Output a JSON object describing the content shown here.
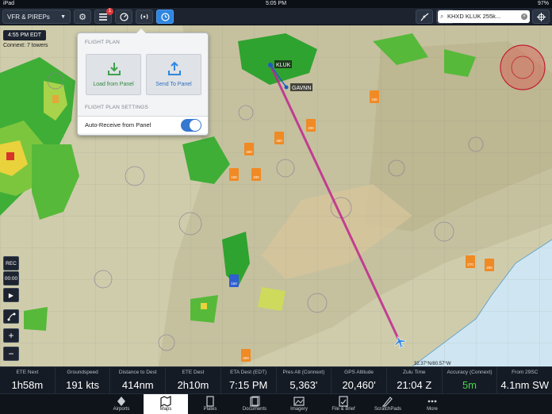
{
  "status_bar": {
    "device": "iPad",
    "time": "5:05 PM",
    "battery": "97%"
  },
  "toolbar": {
    "layer_selector": "VFR & PIREPs",
    "notification_count": "1",
    "search_value": "KHXD KLUK 255k..."
  },
  "map": {
    "time_chip": "4:55 PM EDT",
    "towers_label": "Connext: 7 towers",
    "waypoints": {
      "start": "KLUK",
      "mid": "GAVNN"
    },
    "aircraft_label": "32.37°N/80.57°W",
    "obstacle_labels": [
      "340",
      "200",
      "350",
      "400",
      "100",
      "200",
      "270",
      "200",
      "400"
    ],
    "airport_label": "150"
  },
  "flight_plan_popover": {
    "header": "FLIGHT PLAN",
    "load_label": "Load from Panel",
    "send_label": "Send To Panel",
    "settings_header": "FLIGHT PLAN SETTINGS",
    "auto_receive_label": "Auto-Receive from Panel",
    "auto_receive_on": true
  },
  "side_controls": {
    "rec": "REC",
    "timer": "00:00"
  },
  "instruments": [
    {
      "title": "ETE Next",
      "value": "1h58m"
    },
    {
      "title": "Groundspeed",
      "value": "191 kts"
    },
    {
      "title": "Distance to Dest",
      "value": "414nm"
    },
    {
      "title": "ETE Dest",
      "value": "2h10m"
    },
    {
      "title": "ETA Dest (EDT)",
      "value": "7:15 PM"
    },
    {
      "title": "Pres Alt (Connext)",
      "value": "5,363'"
    },
    {
      "title": "GPS Altitude",
      "value": "20,460'"
    },
    {
      "title": "Zulu Time",
      "value": "21:04 Z"
    },
    {
      "title": "Accuracy (Connext)",
      "value": "5m"
    },
    {
      "title": "From 29SC",
      "value": "4.1nm SW"
    }
  ],
  "tabs": [
    {
      "label": "Airports",
      "icon": "airports-icon"
    },
    {
      "label": "Maps",
      "icon": "maps-icon"
    },
    {
      "label": "Plates",
      "icon": "plates-icon"
    },
    {
      "label": "Documents",
      "icon": "documents-icon"
    },
    {
      "label": "Imagery",
      "icon": "imagery-icon"
    },
    {
      "label": "File & Brief",
      "icon": "file-brief-icon"
    },
    {
      "label": "ScratchPads",
      "icon": "scratchpads-icon"
    },
    {
      "label": "More",
      "icon": "more-icon"
    }
  ],
  "colors": {
    "accent": "#2f86e0",
    "route": "#c0278f",
    "accuracy_value": "#46d44a"
  }
}
